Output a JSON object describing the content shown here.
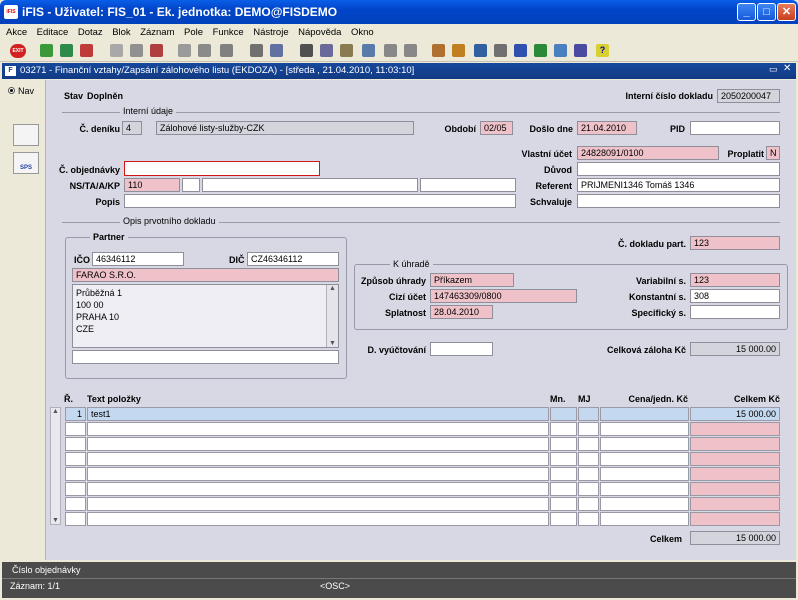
{
  "window": {
    "title": "iFIS - Uživatel: FIS_01 - Ek. jednotka: DEMO@FISDEMO",
    "app_icon": "iFIS"
  },
  "menu": [
    "Akce",
    "Editace",
    "Dotaz",
    "Blok",
    "Záznam",
    "Pole",
    "Funkce",
    "Nástroje",
    "Nápověda",
    "Okno"
  ],
  "toolbar": {
    "exit_label": "EXIT",
    "sps_label": "SPS"
  },
  "form": {
    "title": "03271 - Finanční vztahy/Zapsání zálohového listu (EKDOZA) - [středa , 21.04.2010, 11:03:10]",
    "form_icon": "F",
    "nav_label": "Nav",
    "stav_label": "Stav",
    "stav_value": "Doplněn",
    "interni_cislo_label": "Interní číslo dokladu",
    "interni_cislo_value": "2050200047",
    "section_interni": "Interní údaje",
    "c_deniku_label": "Č. deníku",
    "c_deniku_value": "4",
    "c_deniku_name": "Zálohové listy-služby-CZK",
    "obdobi_label": "Období",
    "obdobi_value": "02/05",
    "doslo_dne_label": "Došlo dne",
    "doslo_dne_value": "21.04.2010",
    "pid_label": "PID",
    "pid_value": "",
    "vlastni_ucet_label": "Vlastní účet",
    "vlastni_ucet_value": "24828091/0100",
    "proplatit_label": "Proplatit",
    "proplatit_value": "N",
    "c_objednavky_label": "Č. objednávky",
    "c_objednavky_value": "",
    "duvod_label": "Důvod",
    "duvod_value": "",
    "ns_label": "NS/TA/A/KP",
    "ns_value": "110",
    "referent_label": "Referent",
    "referent_value": "PRIJMENI1346 Tomáš 1346",
    "popis_label": "Popis",
    "popis_value": "",
    "schvaluje_label": "Schvaluje",
    "schvaluje_value": "",
    "section_opis": "Opis prvotního dokladu",
    "partner_title": "Partner",
    "ico_label": "IČO",
    "ico_value": "46346112",
    "dic_label": "DIČ",
    "dic_value": "CZ46346112",
    "partner_name": "FARAO S.R.O.",
    "address": [
      "Průběžná 1",
      "100 00",
      "PRAHA 10",
      "CZE"
    ],
    "c_dokladu_part_label": "Č. dokladu part.",
    "c_dokladu_part_value": "123",
    "k_uhrade_title": "K úhradě",
    "zpusob_label": "Způsob úhrady",
    "zpusob_value": "Příkazem",
    "cizi_ucet_label": "Cizí účet",
    "cizi_ucet_value": "147463309/0800",
    "splatnost_label": "Splatnost",
    "splatnost_value": "28.04.2010",
    "variabilni_label": "Variabilní s.",
    "variabilni_value": "123",
    "konstantni_label": "Konstantní s.",
    "konstantni_value": "308",
    "specificky_label": "Specifický s.",
    "specificky_value": "",
    "d_vyuct_label": "D. vyúčtování",
    "d_vyuct_value": "",
    "celkova_zaloha_label": "Celková záloha Kč",
    "celkova_zaloha_value": "15 000.00"
  },
  "grid": {
    "headers": {
      "r": "Ř.",
      "text": "Text položky",
      "mn": "Mn.",
      "mj": "MJ",
      "cena": "Cena/jedn. Kč",
      "celkem": "Celkem Kč"
    },
    "rows": [
      {
        "r": "1",
        "text": "test1",
        "mn": "",
        "mj": "",
        "cena": "",
        "celkem": "15 000.00"
      },
      {
        "r": "",
        "text": "",
        "mn": "",
        "mj": "",
        "cena": "",
        "celkem": ""
      },
      {
        "r": "",
        "text": "",
        "mn": "",
        "mj": "",
        "cena": "",
        "celkem": ""
      },
      {
        "r": "",
        "text": "",
        "mn": "",
        "mj": "",
        "cena": "",
        "celkem": ""
      },
      {
        "r": "",
        "text": "",
        "mn": "",
        "mj": "",
        "cena": "",
        "celkem": ""
      },
      {
        "r": "",
        "text": "",
        "mn": "",
        "mj": "",
        "cena": "",
        "celkem": ""
      },
      {
        "r": "",
        "text": "",
        "mn": "",
        "mj": "",
        "cena": "",
        "celkem": ""
      },
      {
        "r": "",
        "text": "",
        "mn": "",
        "mj": "",
        "cena": "",
        "celkem": ""
      }
    ],
    "total_label": "Celkem",
    "total_value": "15 000.00"
  },
  "status": {
    "hint": "Číslo objednávky",
    "record": "Záznam: 1/1",
    "osc": "<OSC>"
  }
}
